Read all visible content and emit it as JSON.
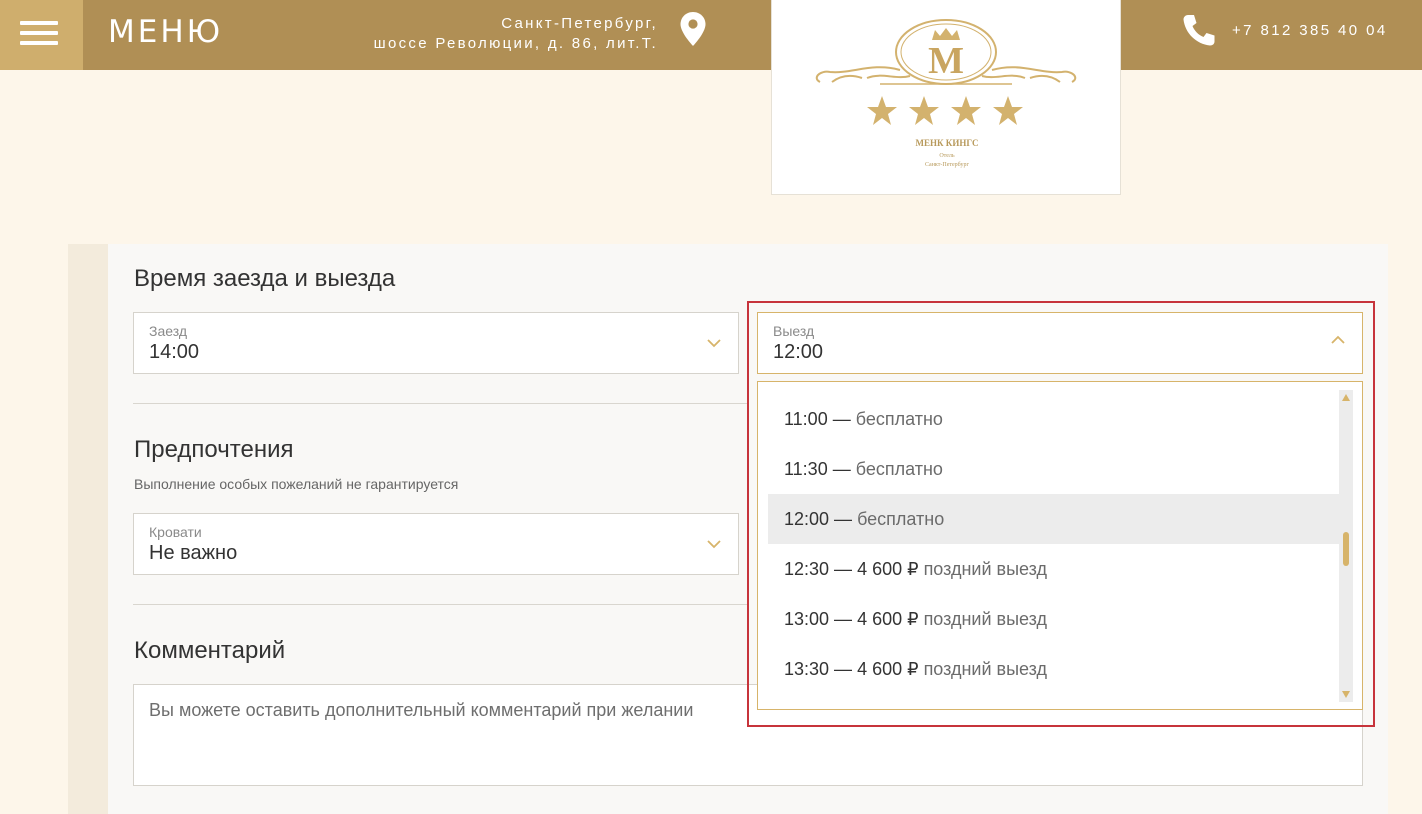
{
  "header": {
    "menu_label": "МЕНЮ",
    "address_line1": "Санкт-Петербург,",
    "address_line2": "шоссе Революции, д. 86, лит.Т.",
    "phone": "+7 812 385 40 04"
  },
  "logo": {
    "monogram": "M",
    "name": "МЕНК КИНГС",
    "subtitle1": "Отель",
    "subtitle2": "Санкт-Петербург"
  },
  "colors": {
    "header_bg": "#b08f55",
    "burger_bg": "#cfae6d",
    "gold_accent": "#d7b46a",
    "page_bg": "#fdf6ea",
    "highlight": "#c7343b"
  },
  "times_section": {
    "title": "Время заезда и выезда",
    "checkin": {
      "label": "Заезд",
      "value": "14:00"
    },
    "checkout": {
      "label": "Выезд",
      "value": "12:00"
    }
  },
  "checkout_options": [
    {
      "time": "11:00",
      "sep": " — ",
      "price": "",
      "desc": "бесплатно",
      "selected": false
    },
    {
      "time": "11:30",
      "sep": " — ",
      "price": "",
      "desc": "бесплатно",
      "selected": false
    },
    {
      "time": "12:00",
      "sep": " — ",
      "price": "",
      "desc": "бесплатно",
      "selected": true
    },
    {
      "time": "12:30",
      "sep": " — ",
      "price": "4 600 ₽",
      "desc": " поздний выезд",
      "selected": false
    },
    {
      "time": "13:00",
      "sep": " — ",
      "price": "4 600 ₽",
      "desc": " поздний выезд",
      "selected": false
    },
    {
      "time": "13:30",
      "sep": " — ",
      "price": "4 600 ₽",
      "desc": " поздний выезд",
      "selected": false
    }
  ],
  "preferences": {
    "title": "Предпочтения",
    "subtitle": "Выполнение особых пожеланий не гарантируется",
    "beds": {
      "label": "Кровати",
      "value": "Не важно"
    }
  },
  "comment": {
    "title": "Комментарий",
    "placeholder": "Вы можете оставить дополнительный комментарий при желании"
  }
}
